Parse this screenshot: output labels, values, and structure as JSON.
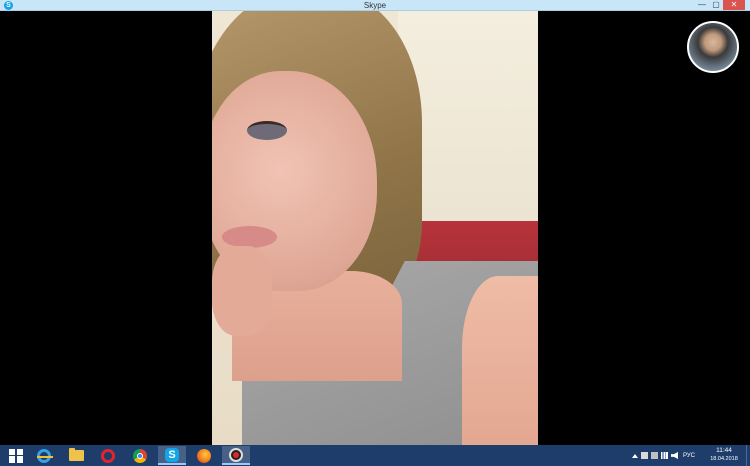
{
  "window": {
    "title": "Skype",
    "app_icon": "skype-icon",
    "controls": {
      "minimize": "—",
      "maximize": "▢",
      "close": "✕"
    }
  },
  "call": {
    "remote_video": "remote-video-feed",
    "self_view": "self-view-avatar"
  },
  "taskbar": {
    "color": "#1f3d6b",
    "apps": [
      {
        "name": "start",
        "icon": "windows-start-icon"
      },
      {
        "name": "internet-explorer",
        "icon": "internet-explorer-icon"
      },
      {
        "name": "file-explorer",
        "icon": "folder-icon"
      },
      {
        "name": "opera",
        "icon": "opera-icon"
      },
      {
        "name": "chrome",
        "icon": "chrome-icon"
      },
      {
        "name": "skype",
        "icon": "skype-icon",
        "active": true
      },
      {
        "name": "firefox",
        "icon": "firefox-icon"
      },
      {
        "name": "recorder",
        "icon": "record-icon"
      }
    ],
    "tray": {
      "language": "РУС",
      "time": "11:44",
      "date": "18.04.2018"
    }
  },
  "colors": {
    "titlebar": "#c9e6f9",
    "close_button": "#d9534f",
    "skype_blue": "#12a5e8"
  }
}
